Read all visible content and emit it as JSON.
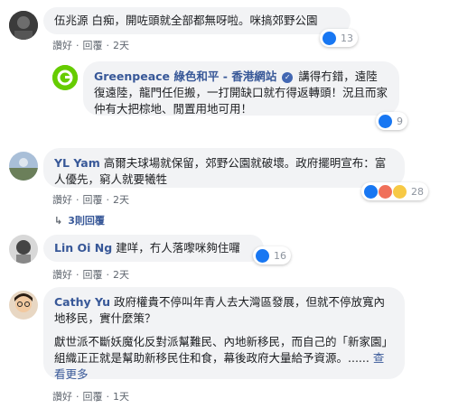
{
  "comments": [
    {
      "author": "伍兆源",
      "text": "白痴，開咗頭就全部都無呀啦。咪搞郊野公園",
      "like_label": "讚好",
      "reply_label": "回覆",
      "time": "2天",
      "reaction_count": "13"
    },
    {
      "author": "Greenpeace 綠色和平 - 香港網站",
      "verified_icon": "check-icon",
      "text": "講得冇錯，遠陸復遠陸，龍門任佢搬，一打開缺口就冇得返轉頭！況且而家仲有大把棕地、閒置用地可用！",
      "reaction_count": "9"
    },
    {
      "author": "YL Yam",
      "text": "高爾夫球場就保留，郊野公園就破壞。政府擺明宣布：富人優先，窮人就要犧牲",
      "like_label": "讚好",
      "reply_label": "回覆",
      "time": "2天",
      "reaction_count": "28",
      "replies_label": "3則回覆"
    },
    {
      "author": "Lin Oi Ng",
      "text": "建咩，冇人落嚟咪夠住囉",
      "like_label": "讚好",
      "reply_label": "回覆",
      "time": "2天",
      "reaction_count": "16"
    },
    {
      "author": "Cathy Yu",
      "text": "政府權貴不停叫年青人去大灣區發展，但就不停放寬內地移民，實什麼策？",
      "text2": "獻世派不斷妖魔化反對派幫難民、內地新移民，而自己的「新家園」組織正正就是幫助新移民住和食，幕後政府大量給予資源。......",
      "see_more": "查看更多",
      "like_label": "讚好",
      "reply_label": "回覆",
      "time": "1天"
    }
  ],
  "colors": {
    "link": "#385898",
    "like": "#1877f2",
    "bubble": "#f2f3f5"
  }
}
